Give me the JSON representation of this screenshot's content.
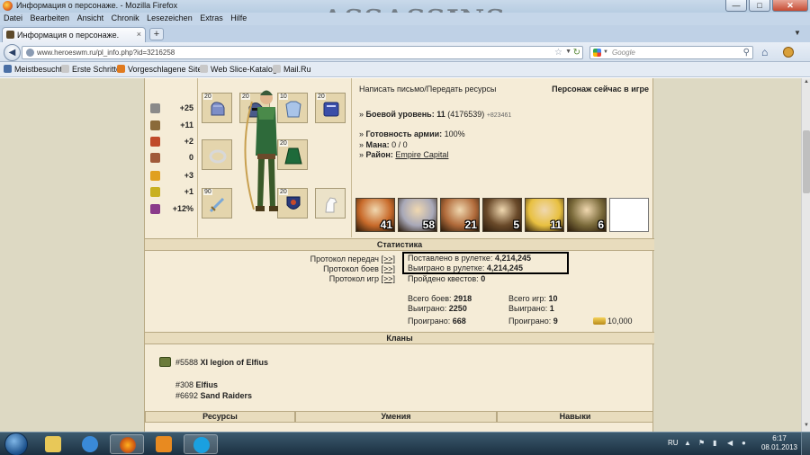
{
  "window": {
    "title": "Информация о персонаже. - Mozilla Firefox",
    "minimize": "—",
    "maximize": "□",
    "close": "✕"
  },
  "menu": [
    "Datei",
    "Bearbeiten",
    "Ansicht",
    "Chronik",
    "Lesezeichen",
    "Extras",
    "Hilfe"
  ],
  "tab": {
    "label": "Информация о персонаже.",
    "close": "×",
    "new_tab": "+"
  },
  "nav": {
    "back": "◀",
    "url": "www.heroeswm.ru/pl_info.php?id=3216258",
    "search_placeholder": "Google"
  },
  "bookmarks": [
    {
      "label": "Meistbesucht",
      "color": "#4a6fa5"
    },
    {
      "label": "Erste Schritte",
      "color": "#c8c8c8"
    },
    {
      "label": "Vorgeschlagene Sites",
      "color": "#e07a1f"
    },
    {
      "label": "Web Slice-Katalog",
      "color": "#c8c8c8"
    },
    {
      "label": "Mail.Ru",
      "color": "#c8c8c8"
    }
  ],
  "hero_stats": [
    {
      "icon": "sword-icon",
      "value": "+25",
      "color": "#8a8a8a"
    },
    {
      "icon": "shield-icon",
      "value": "+11",
      "color": "#8a6a3a"
    },
    {
      "icon": "wand-icon",
      "value": "+2",
      "color": "#c04a2a"
    },
    {
      "icon": "book-icon",
      "value": "0",
      "color": "#a05a3a"
    },
    {
      "icon": "rainbow-icon",
      "value": "+3",
      "color": "#e0a020"
    },
    {
      "icon": "horseshoe-icon",
      "value": "+1",
      "color": "#c8b020"
    },
    {
      "icon": "potion-icon",
      "value": "+12%",
      "color": "#8a3a8a"
    }
  ],
  "equipment": {
    "levels": {
      "gloves": "20",
      "helmet": "20",
      "armor": "10",
      "book": "20",
      "cloak": "20",
      "weapon": "90",
      "shield": "20"
    }
  },
  "info": {
    "mail_link": "Написать письмо/Передать ресурсы",
    "online_status": "Персонаж сейчас в игре",
    "level_label": "Боевой уровень:",
    "level_value": "11",
    "level_exp": "(4176539)",
    "level_bonus": "+823461",
    "army_label": "Готовность армии:",
    "army_value": "100%",
    "mana_label": "Мана:",
    "mana_value": "0 / 0",
    "district_label": "Район:",
    "district_value": "Empire Capital"
  },
  "army": [
    {
      "count": "41",
      "color": "#c86a2a"
    },
    {
      "count": "58",
      "color": "#a8a8b8"
    },
    {
      "count": "21",
      "color": "#b06a3a"
    },
    {
      "count": "5",
      "color": "#6a4a2a"
    },
    {
      "count": "11",
      "color": "#e8c040"
    },
    {
      "count": "6",
      "color": "#7a6a3a"
    },
    {
      "count": "",
      "color": "#ffffff"
    }
  ],
  "statistics": {
    "title": "Статистика",
    "protocols": [
      {
        "label": "Протокол передач",
        "link": "[>>]"
      },
      {
        "label": "Протокол боев",
        "link": "[>>]"
      },
      {
        "label": "Протокол игр",
        "link": "[>>]"
      }
    ],
    "roulette_bet_label": "Поставлено в рулетке:",
    "roulette_bet_value": "4,214,245",
    "roulette_won_label": "Выиграно в рулетке:",
    "roulette_won_value": "4,214,245",
    "quests_label": "Пройдено квестов:",
    "quests_value": "0",
    "battles_total_label": "Всего боев:",
    "battles_total_value": "2918",
    "battles_won_label": "Выиграно:",
    "battles_won_value": "2250",
    "battles_lost_label": "Проиграно:",
    "battles_lost_value": "668",
    "games_total_label": "Всего игр:",
    "games_total_value": "10",
    "games_won_label": "Выиграно:",
    "games_won_value": "1",
    "games_lost_label": "Проиграно:",
    "games_lost_value": "9",
    "gold": "10,000"
  },
  "clans": {
    "title": "Кланы",
    "list": [
      {
        "id": "#5588",
        "name": "XI legion of Elfius"
      },
      {
        "id": "#308",
        "name": "Elfius"
      },
      {
        "id": "#6692",
        "name": "Sand Raiders"
      }
    ]
  },
  "bottom_sections": [
    "Ресурсы",
    "Умения",
    "Навыки"
  ],
  "taskbar": {
    "lang": "RU",
    "time": "6:17",
    "date": "08.01.2013"
  }
}
